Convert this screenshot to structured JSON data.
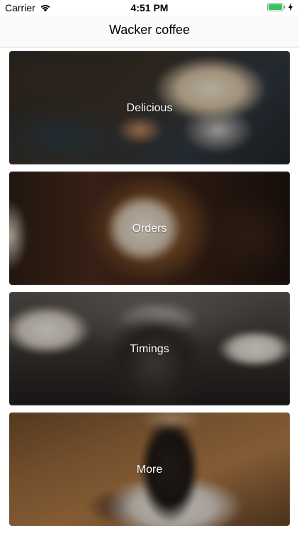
{
  "status_bar": {
    "carrier": "Carrier",
    "time": "4:51 PM",
    "battery_color": "#34c759"
  },
  "nav": {
    "title": "Wacker coffee"
  },
  "cards": [
    {
      "label": "Delicious",
      "image": "latte-art-cup"
    },
    {
      "label": "Orders",
      "image": "cappuccino-top"
    },
    {
      "label": "Timings",
      "image": "iced-coffee-cake"
    },
    {
      "label": "More",
      "image": "coffee-mug-beans"
    }
  ]
}
